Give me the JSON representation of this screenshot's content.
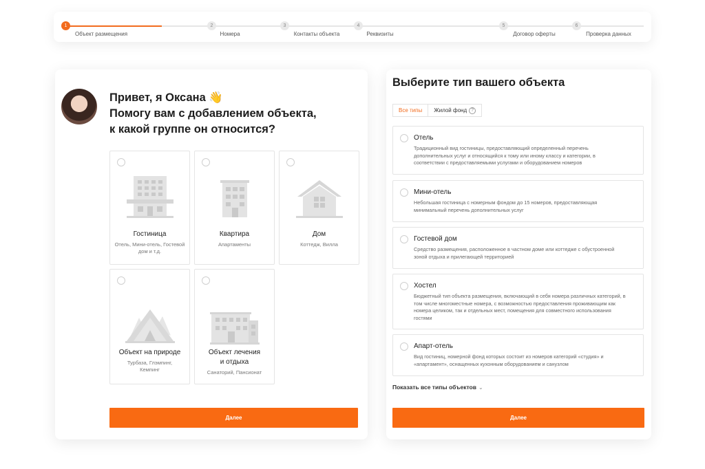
{
  "stepper": {
    "steps": [
      {
        "num": "1",
        "label": "Объект размещения"
      },
      {
        "num": "2",
        "label": "Номера"
      },
      {
        "num": "3",
        "label": "Контакты объекта"
      },
      {
        "num": "4",
        "label": "Реквизиты"
      },
      {
        "num": "5",
        "label": "Договор оферты"
      },
      {
        "num": "6",
        "label": "Проверка данных"
      }
    ],
    "current": 1,
    "accent": "#f26b1d"
  },
  "left": {
    "greeting_line1": "Привет, я Оксана",
    "wave_emoji": "👋",
    "greeting_line2": "Помогу вам с добавлением объекта,",
    "greeting_line3": "к какой группе он относится?",
    "groups": [
      {
        "icon": "hotel-building-icon",
        "title": "Гостиница",
        "sub": "Отель, Мини-отель, Гостевой дом и т.д."
      },
      {
        "icon": "apartment-building-icon",
        "title": "Квартира",
        "sub": "Апартаменты"
      },
      {
        "icon": "house-icon",
        "title": "Дом",
        "sub": "Коттедж, Вилла"
      },
      {
        "icon": "tent-nature-icon",
        "title": "Объект на природе",
        "sub": "Турбаза, Глэмпинг, Кемпинг"
      },
      {
        "icon": "sanatorium-building-icon",
        "title1": "Объект лечения",
        "title2": "и отдыха",
        "sub": "Санаторий, Пансионат"
      }
    ],
    "next_label": "Далее"
  },
  "right": {
    "title": "Выберите тип вашего объекта",
    "tabs": [
      {
        "label": "Все типы",
        "active": true
      },
      {
        "label": "Жилой фонд",
        "active": false
      }
    ],
    "options": [
      {
        "title": "Отель",
        "desc": "Традиционный вид гостиницы, предоставляющий определенный перечень дополнительных услуг и относящийся к тому или иному классу и категории, в соответствии с предоставляемыми услугами и оборудованием номеров"
      },
      {
        "title": "Мини-отель",
        "desc": "Небольшая гостиница с номерным фондом до 15 номеров, предоставляющая минимальный перечень дополнительных услуг"
      },
      {
        "title": "Гостевой дом",
        "desc": "Средство размещения, расположенное в частном доме или коттедже с обустроенной зоной отдыха и прилегающей территорией"
      },
      {
        "title": "Хостел",
        "desc": "Бюджетный тип объекта размещения, включающий в себя номера различных категорий, в том числе многоместные номера, с возможностью предоставления проживающим как номера целиком, так и отдельных мест, помещения для совместного использования гостями"
      },
      {
        "title": "Апарт-отель",
        "desc": "Вид гостиниц, номерной фонд которых состоит из номеров категорий «студия» и «апартамент», оснащенных кухонным оборудованием и санузлом"
      }
    ],
    "show_all": "Показать все типы объектов",
    "next_label": "Далее"
  }
}
